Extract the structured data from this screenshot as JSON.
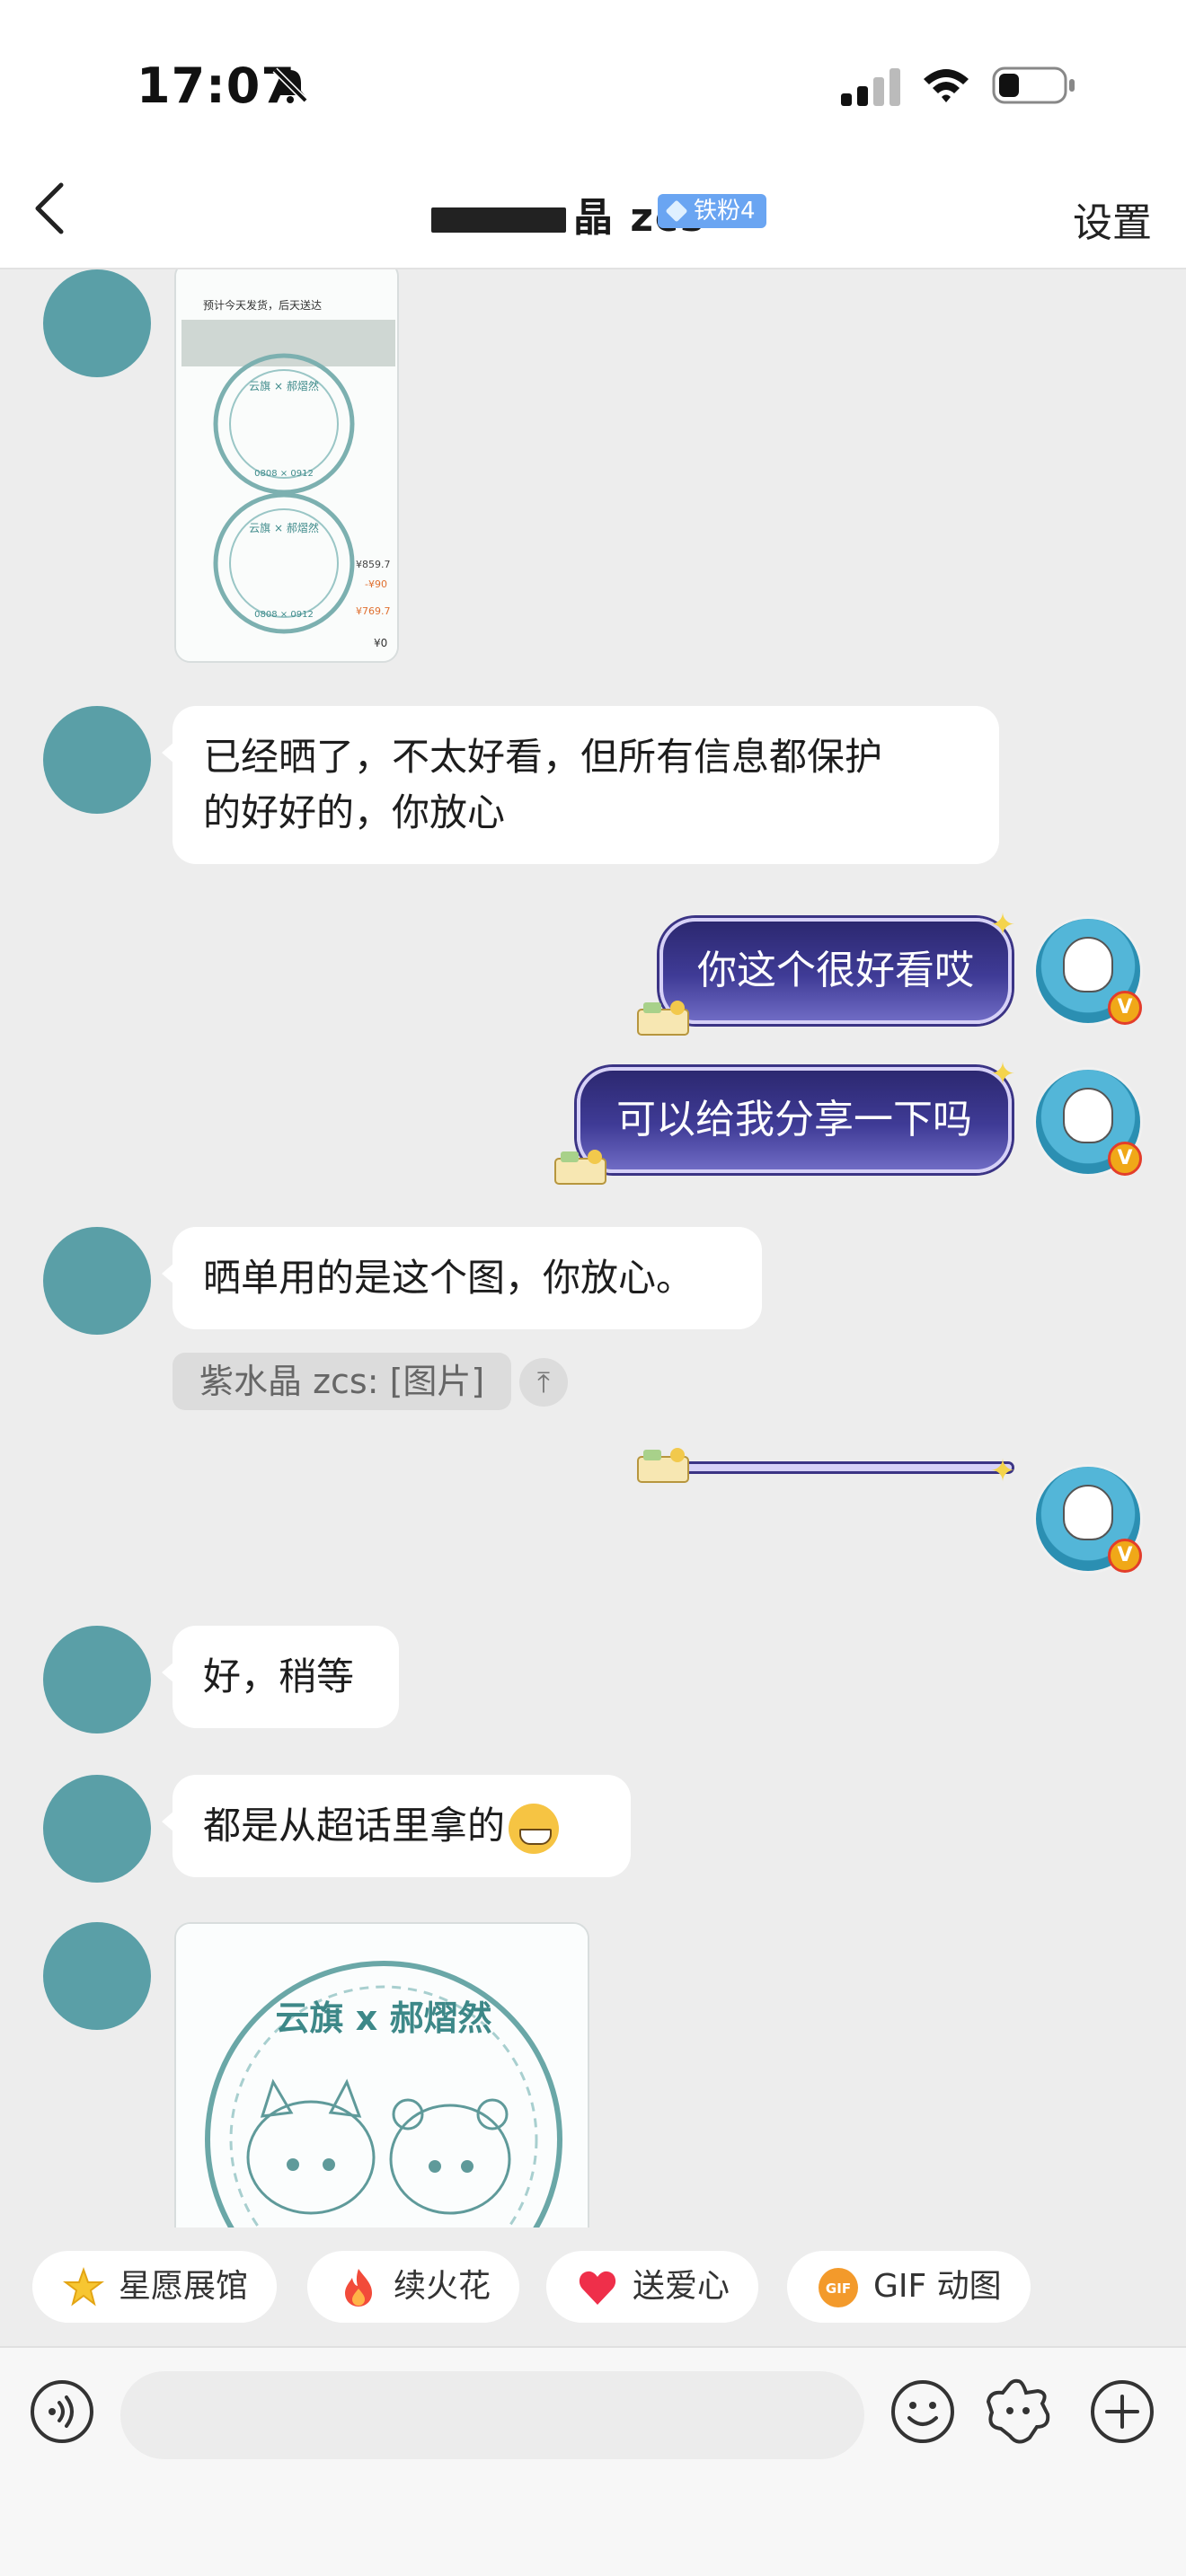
{
  "status_bar": {
    "time": "17:07"
  },
  "header": {
    "title": "晶 zcs",
    "fan_badge": "铁粉4",
    "settings_label": "设置"
  },
  "messages": [
    {
      "side": "left",
      "type": "image"
    },
    {
      "side": "left",
      "type": "text",
      "text_line1": "已经晒了，不太好看，但所有信息都保护",
      "text_line2": "的好好的，你放心"
    },
    {
      "side": "right",
      "type": "text",
      "text": "你这个很好看哎"
    },
    {
      "side": "right",
      "type": "text",
      "text": "可以给我分享一下吗"
    },
    {
      "side": "left",
      "type": "text",
      "text": "晒单用的是这个图，你放心。"
    },
    {
      "side": "left",
      "type": "quote",
      "text": "紫水晶 zcs: [图片]",
      "pin_icon": "arrow-to-top"
    },
    {
      "side": "right",
      "type": "text",
      "text": ""
    },
    {
      "side": "left",
      "type": "text",
      "text": "好，稍等"
    },
    {
      "side": "left",
      "type": "text",
      "text": "都是从超话里拿的",
      "emoji": "grinning-face"
    },
    {
      "side": "left",
      "type": "image"
    }
  ],
  "image_card_1": {
    "line1": "预计今天发货，后天送达",
    "stamp_top": "云旗 × 郝熠然",
    "stamp_bottom": "0808 × 0912",
    "price1": "¥859.7",
    "price2": "-¥90",
    "price3": "¥769.7",
    "price4": "¥0"
  },
  "image_card_2": {
    "stamp_title": "云旗 x 郝熠然"
  },
  "quick_chips": [
    {
      "label": "星愿展馆",
      "icon": "star-icon"
    },
    {
      "label": "续火花",
      "icon": "fire-icon"
    },
    {
      "label": "送爱心",
      "icon": "heart-icon"
    },
    {
      "label": "GIF 动图",
      "icon": "gif-icon"
    }
  ],
  "input": {
    "placeholder": ""
  },
  "colors": {
    "avatar_teal": "#5a9fa7",
    "bubble_purple": "#3f3b96",
    "fan_badge_blue": "#6aa5f2",
    "background": "#ededed"
  }
}
